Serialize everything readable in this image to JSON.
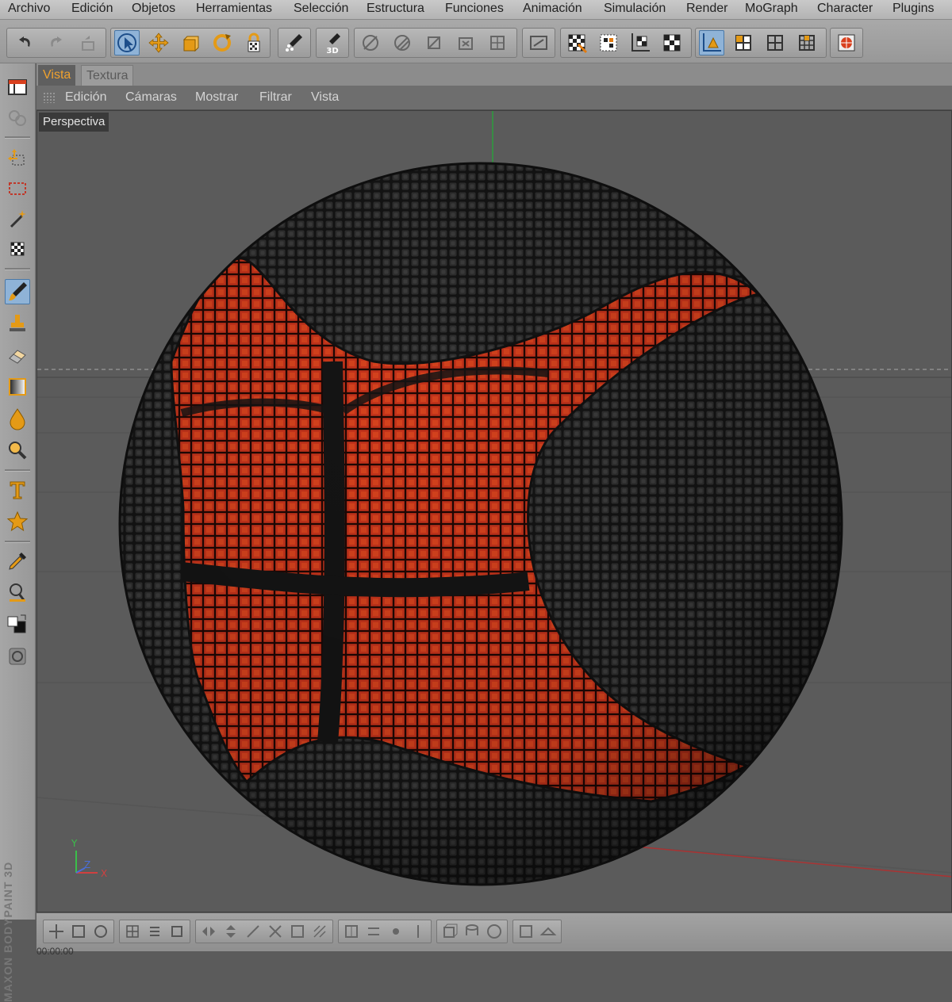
{
  "menubar": {
    "items": [
      "Archivo",
      "Edición",
      "Objetos",
      "Herramientas",
      "Selección",
      "Estructura",
      "Funciones",
      "Animación",
      "Simulación",
      "Render",
      "MoGraph",
      "Character",
      "Plugins"
    ]
  },
  "view": {
    "tabs": [
      "Vista",
      "Textura"
    ],
    "active_tab": "Vista",
    "menu": [
      "Edición",
      "Cámaras",
      "Mostrar",
      "Filtrar",
      "Vista"
    ],
    "camera_label": "Perspectiva",
    "axis_labels": {
      "y": "Y",
      "z": "Z",
      "x": "X"
    }
  },
  "brand": {
    "text": "MAXON BODYPAINT 3D"
  },
  "status": {
    "time": "00:00:00"
  },
  "toolbar": {
    "icons": [
      "undo-icon",
      "redo-icon",
      "undo-view-icon",
      "live-selection-icon",
      "move-icon",
      "scale-icon",
      "rotate-icon",
      "lock-axis-icon",
      "paint-setup-icon",
      "3d-paint-icon",
      "points-mode-icon",
      "edges-mode-icon",
      "polygons-mode-icon",
      "uv-points-icon",
      "uv-polygons-icon",
      "projection-icon",
      "render-view-icon",
      "render-region-icon",
      "render-settings-icon",
      "render-picture-viewer-icon",
      "workplane-icon",
      "object-icon",
      "model-icon",
      "texture-mode-icon",
      "globe-render-icon"
    ],
    "active": [
      "live-selection-icon",
      "workplane-icon"
    ]
  },
  "leftbar": {
    "icons": [
      "layout-icon",
      "paint-layer-icon",
      "move-tool-icon",
      "selection-rect-icon",
      "magic-wand-icon",
      "texture-select-icon",
      "brush-icon",
      "clone-stamp-icon",
      "eraser-icon",
      "gradient-icon",
      "drop-icon",
      "zoom-tool-icon",
      "text-tool-icon",
      "star-shape-icon",
      "eyedropper-icon",
      "magnifier-icon",
      "color-swap-icon",
      "material-icon"
    ]
  },
  "colors": {
    "accent": "#f0a22e",
    "ball_red": "#c8321a",
    "ball_black": "#161616",
    "viewport_bg": "#5b5b5b",
    "wire": "#1a1a1a"
  }
}
